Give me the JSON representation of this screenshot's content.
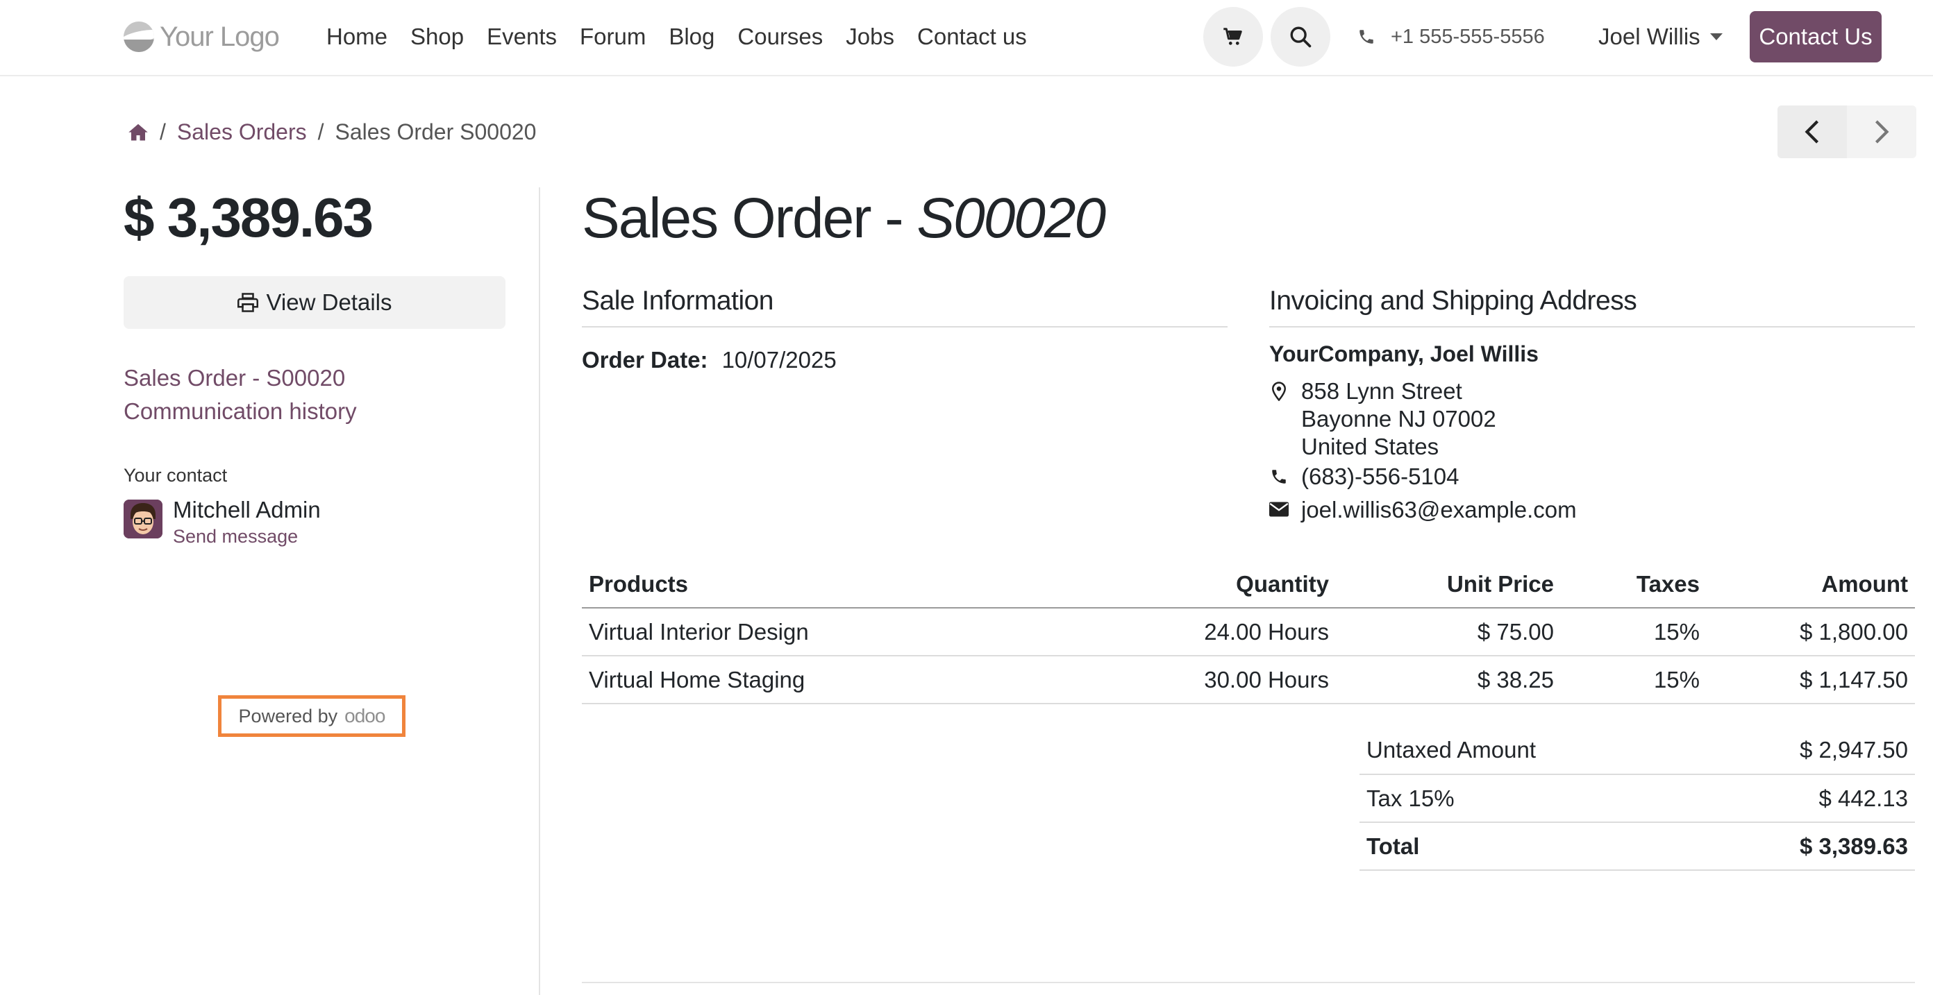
{
  "header": {
    "logo_text": "Your Logo",
    "nav": [
      "Home",
      "Shop",
      "Events",
      "Forum",
      "Blog",
      "Courses",
      "Jobs",
      "Contact us"
    ],
    "phone": "+1 555-555-5556",
    "user_name": "Joel Willis",
    "contact_button": "Contact Us"
  },
  "breadcrumb": {
    "items": [
      "Sales Orders",
      "Sales Order S00020"
    ]
  },
  "sidebar": {
    "amount": "$ 3,389.63",
    "view_details": "View Details",
    "links": [
      "Sales Order - S00020",
      "Communication history"
    ],
    "contact_label": "Your contact",
    "contact_name": "Mitchell Admin",
    "send_message": "Send message",
    "powered_by": "Powered by",
    "powered_brand": "odoo"
  },
  "order": {
    "title_prefix": "Sales Order - ",
    "title_ref": "S00020",
    "sale_info_heading": "Sale Information",
    "order_date_label": "Order Date:",
    "order_date": "10/07/2025",
    "address_heading": "Invoicing and Shipping Address",
    "company": "YourCompany, Joel Willis",
    "address_lines": [
      "858 Lynn Street",
      "Bayonne NJ 07002",
      "United States"
    ],
    "phone": "(683)-556-5104",
    "email": "joel.willis63@example.com"
  },
  "lines": {
    "headers": [
      "Products",
      "Quantity",
      "Unit Price",
      "Taxes",
      "Amount"
    ],
    "rows": [
      [
        "Virtual Interior Design",
        "24.00 Hours",
        "$ 75.00",
        "15%",
        "$ 1,800.00"
      ],
      [
        "Virtual Home Staging",
        "30.00 Hours",
        "$ 38.25",
        "15%",
        "$ 1,147.50"
      ]
    ]
  },
  "totals": {
    "untaxed_label": "Untaxed Amount",
    "untaxed_value": "$ 2,947.50",
    "tax_label": "Tax 15%",
    "tax_value": "$ 442.13",
    "total_label": "Total",
    "total_value": "$ 3,389.63"
  },
  "colors": {
    "brand": "#714b67",
    "highlight": "#f0843c"
  }
}
